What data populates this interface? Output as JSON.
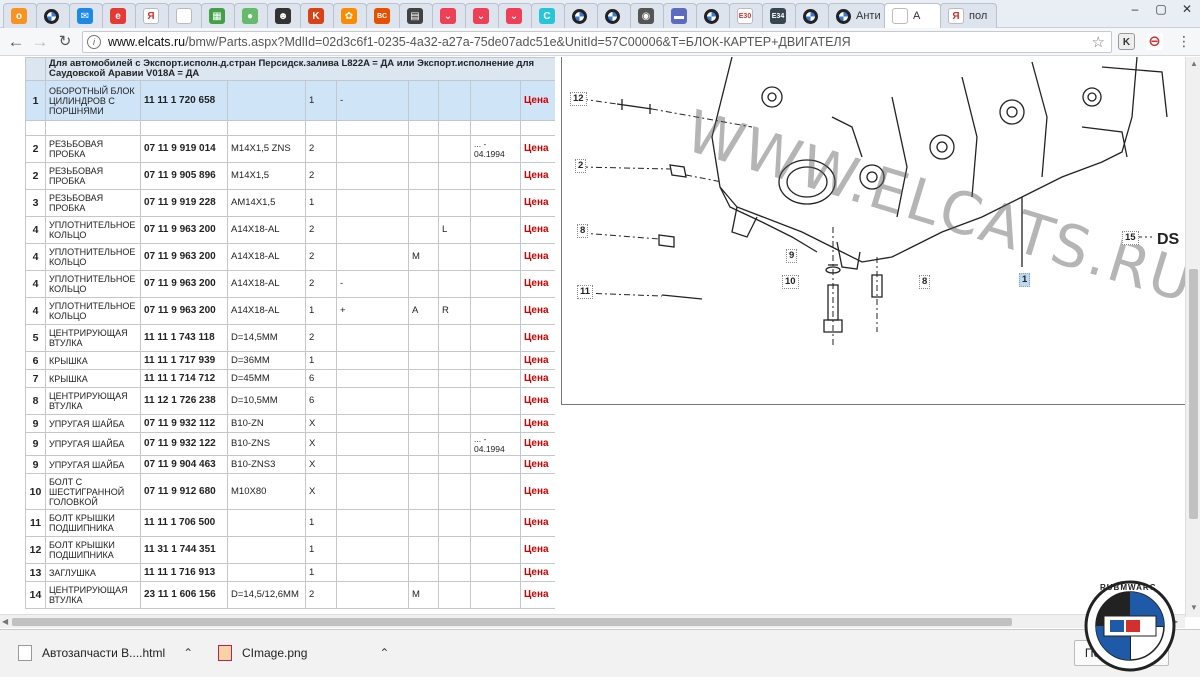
{
  "browser": {
    "tabs": [
      {
        "favicon": "ok-icon",
        "color": "#f7931e",
        "glyph": "о",
        "label": ""
      },
      {
        "favicon": "bmw-icon",
        "color": "#ffffff",
        "glyph": "",
        "label": ""
      },
      {
        "favicon": "mail-icon",
        "color": "#1e88e5",
        "glyph": "✉",
        "label": ""
      },
      {
        "favicon": "globe-icon",
        "color": "#e53935",
        "glyph": "e",
        "label": ""
      },
      {
        "favicon": "yandex-icon",
        "color": "#ffffff",
        "glyph": "Я",
        "label": ""
      },
      {
        "favicon": "page-icon",
        "color": "#ffffff",
        "glyph": "",
        "label": ""
      },
      {
        "favicon": "sheet-icon",
        "color": "#43a047",
        "glyph": "▦",
        "label": ""
      },
      {
        "favicon": "leaf-icon",
        "color": "#66bb6a",
        "glyph": "●",
        "label": ""
      },
      {
        "favicon": "face-icon",
        "color": "#333333",
        "glyph": "☻",
        "label": ""
      },
      {
        "favicon": "ki-icon",
        "color": "#d84315",
        "glyph": "K",
        "label": ""
      },
      {
        "favicon": "ball-icon",
        "color": "#fb8c00",
        "glyph": "✿",
        "label": ""
      },
      {
        "favicon": "bc-icon",
        "color": "#e65100",
        "glyph": "BC",
        "label": ""
      },
      {
        "favicon": "film-icon",
        "color": "#424242",
        "glyph": "▤",
        "label": ""
      },
      {
        "favicon": "pocket-icon",
        "color": "#ef3f56",
        "glyph": "⌄",
        "label": ""
      },
      {
        "favicon": "pocket-icon",
        "color": "#ef3f56",
        "glyph": "⌄",
        "label": ""
      },
      {
        "favicon": "pocket-icon",
        "color": "#ef3f56",
        "glyph": "⌄",
        "label": ""
      },
      {
        "favicon": "c-icon",
        "color": "#26c6da",
        "glyph": "C",
        "label": ""
      },
      {
        "favicon": "bmw-icon",
        "color": "#ffffff",
        "glyph": "",
        "label": ""
      },
      {
        "favicon": "bmw-icon",
        "color": "#ffffff",
        "glyph": "",
        "label": ""
      },
      {
        "favicon": "car-icon",
        "color": "#555555",
        "glyph": "◉",
        "label": ""
      },
      {
        "favicon": "road-icon",
        "color": "#5c6bc0",
        "glyph": "▬",
        "label": ""
      },
      {
        "favicon": "bmw-icon",
        "color": "#ffffff",
        "glyph": "",
        "label": ""
      },
      {
        "favicon": "e30-icon",
        "color": "#ffffff",
        "glyph": "E30",
        "label": ""
      },
      {
        "favicon": "e34-icon",
        "color": "#37474f",
        "glyph": "E34",
        "label": ""
      },
      {
        "favicon": "bmw-icon",
        "color": "#ffffff",
        "glyph": "",
        "label": ""
      },
      {
        "favicon": "bmw-icon",
        "color": "#ffffff",
        "glyph": "",
        "label": "Анти"
      },
      {
        "favicon": "page-icon",
        "color": "#ffffff",
        "glyph": "",
        "label": "А"
      },
      {
        "favicon": "yandex-icon",
        "color": "#ffffff",
        "glyph": "Я",
        "label": "пол"
      }
    ],
    "url_host": "www.elcats.ru",
    "url_rest": "/bmw/Parts.aspx?MdlId=02d3c6f1-0235-4a32-a27a-75de07adc51e&UnitId=57C00006&T=БЛОК-КАРТЕР+ДВИГАТЕЛЯ",
    "ext_icons": [
      {
        "name": "k-ext-icon",
        "glyph": "K",
        "bg": "#eeeeee",
        "fg": "#333333"
      },
      {
        "name": "record-ext-icon",
        "glyph": "⊖",
        "bg": "#ffffff",
        "fg": "#d32f2f"
      }
    ]
  },
  "parts_table": {
    "header_text": "Для автомобилей с Экспорт.исполн.д.стран Персидск.залива L822A = ДА или Экспорт.исполнение для Саудовской Аравии V018A = ДА",
    "rows": [
      {
        "pos": "1",
        "name": "ОБОРОТНЫЙ БЛОК ЦИЛИНДРОВ С ПОРШНЯМИ",
        "number": "11 11 1 720 658",
        "spec": "",
        "qty": "1",
        "c1": "-",
        "c2": "",
        "c3": "",
        "c4": "",
        "price": "Цена",
        "selected": true
      },
      {
        "pos": "",
        "name": "",
        "number": "",
        "spec": "",
        "qty": "",
        "c1": "",
        "c2": "",
        "c3": "",
        "c4": "",
        "price": "",
        "blank": true
      },
      {
        "pos": "2",
        "name": "РЕЗЬБОВАЯ ПРОБКА",
        "number": "07 11 9 919 014",
        "spec": "M14X1,5 ZNS",
        "qty": "2",
        "c1": "",
        "c2": "",
        "c3": "",
        "c4": "... - 04.1994",
        "price": "Цена"
      },
      {
        "pos": "2",
        "name": "РЕЗЬБОВАЯ ПРОБКА",
        "number": "07 11 9 905 896",
        "spec": "M14X1,5",
        "qty": "2",
        "c1": "",
        "c2": "",
        "c3": "",
        "c4": "",
        "price": "Цена"
      },
      {
        "pos": "3",
        "name": "РЕЗЬБОВАЯ ПРОБКА",
        "number": "07 11 9 919 228",
        "spec": "AM14X1,5",
        "qty": "1",
        "c1": "",
        "c2": "",
        "c3": "",
        "c4": "",
        "price": "Цена"
      },
      {
        "pos": "4",
        "name": "УПЛОТНИТЕЛЬНОЕ КОЛЬЦО",
        "number": "07 11 9 963 200",
        "spec": "A14X18-AL",
        "qty": "2",
        "c1": "",
        "c2": "",
        "c3": "L",
        "c4": "",
        "price": "Цена"
      },
      {
        "pos": "4",
        "name": "УПЛОТНИТЕЛЬНОЕ КОЛЬЦО",
        "number": "07 11 9 963 200",
        "spec": "A14X18-AL",
        "qty": "2",
        "c1": "",
        "c2": "M",
        "c3": "",
        "c4": "",
        "price": "Цена"
      },
      {
        "pos": "4",
        "name": "УПЛОТНИТЕЛЬНОЕ КОЛЬЦО",
        "number": "07 11 9 963 200",
        "spec": "A14X18-AL",
        "qty": "2",
        "c1": "-",
        "c2": "",
        "c3": "",
        "c4": "",
        "price": "Цена"
      },
      {
        "pos": "4",
        "name": "УПЛОТНИТЕЛЬНОЕ КОЛЬЦО",
        "number": "07 11 9 963 200",
        "spec": "A14X18-AL",
        "qty": "1",
        "c1": "+",
        "c2": "A",
        "c3": "R",
        "c4": "",
        "price": "Цена"
      },
      {
        "pos": "5",
        "name": "ЦЕНТРИРУЮЩАЯ ВТУЛКА",
        "number": "11 11 1 743 118",
        "spec": "D=14,5MM",
        "qty": "2",
        "c1": "",
        "c2": "",
        "c3": "",
        "c4": "",
        "price": "Цена"
      },
      {
        "pos": "6",
        "name": "КРЫШКА",
        "number": "11 11 1 717 939",
        "spec": "D=36MM",
        "qty": "1",
        "c1": "",
        "c2": "",
        "c3": "",
        "c4": "",
        "price": "Цена"
      },
      {
        "pos": "7",
        "name": "КРЫШКА",
        "number": "11 11 1 714 712",
        "spec": "D=45MM",
        "qty": "6",
        "c1": "",
        "c2": "",
        "c3": "",
        "c4": "",
        "price": "Цена"
      },
      {
        "pos": "8",
        "name": "ЦЕНТРИРУЮЩАЯ ВТУЛКА",
        "number": "11 12 1 726 238",
        "spec": "D=10,5MM",
        "qty": "6",
        "c1": "",
        "c2": "",
        "c3": "",
        "c4": "",
        "price": "Цена"
      },
      {
        "pos": "9",
        "name": "УПРУГАЯ ШАЙБА",
        "number": "07 11 9 932 112",
        "spec": "B10-ZN",
        "qty": "X",
        "c1": "",
        "c2": "",
        "c3": "",
        "c4": "",
        "price": "Цена"
      },
      {
        "pos": "9",
        "name": "УПРУГАЯ ШАЙБА",
        "number": "07 11 9 932 122",
        "spec": "B10-ZNS",
        "qty": "X",
        "c1": "",
        "c2": "",
        "c3": "",
        "c4": "... - 04.1994",
        "price": "Цена"
      },
      {
        "pos": "9",
        "name": "УПРУГАЯ ШАЙБА",
        "number": "07 11 9 904 463",
        "spec": "B10-ZNS3",
        "qty": "X",
        "c1": "",
        "c2": "",
        "c3": "",
        "c4": "",
        "price": "Цена"
      },
      {
        "pos": "10",
        "name": "БОЛТ С ШЕСТИГРАННОЙ ГОЛОВКОЙ",
        "number": "07 11 9 912 680",
        "spec": "M10X80",
        "qty": "X",
        "c1": "",
        "c2": "",
        "c3": "",
        "c4": "",
        "price": "Цена"
      },
      {
        "pos": "11",
        "name": "БОЛТ КРЫШКИ ПОДШИПНИКА",
        "number": "11 11 1 706 500",
        "spec": "",
        "qty": "1",
        "c1": "",
        "c2": "",
        "c3": "",
        "c4": "",
        "price": "Цена"
      },
      {
        "pos": "12",
        "name": "БОЛТ КРЫШКИ ПОДШИПНИКА",
        "number": "11 31 1 744 351",
        "spec": "",
        "qty": "1",
        "c1": "",
        "c2": "",
        "c3": "",
        "c4": "",
        "price": "Цена"
      },
      {
        "pos": "13",
        "name": "ЗАГЛУШКА",
        "number": "11 11 1 716 913",
        "spec": "",
        "qty": "1",
        "c1": "",
        "c2": "",
        "c3": "",
        "c4": "",
        "price": "Цена"
      },
      {
        "pos": "14",
        "name": "ЦЕНТРИРУЮЩАЯ ВТУЛКА",
        "number": "23 11 1 606 156",
        "spec": "D=14,5/12,6MM",
        "qty": "2",
        "c1": "",
        "c2": "M",
        "c3": "",
        "c4": "",
        "price": "Цена"
      }
    ]
  },
  "diagram": {
    "watermark": "WWW.ELCATS.RU",
    "callouts": [
      "12",
      "2",
      "8",
      "11",
      "9",
      "10",
      "8",
      "15",
      "1"
    ],
    "trailing_text": "DS"
  },
  "downloads": {
    "items": [
      {
        "name": "Автозапчасти В....html"
      },
      {
        "name": "CImage.png"
      }
    ],
    "show_all": "Показать все"
  },
  "logo": {
    "text": "RUBMWARC"
  }
}
